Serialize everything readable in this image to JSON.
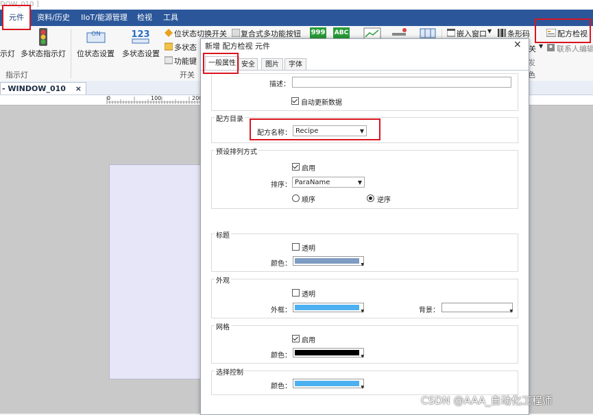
{
  "window_title_fragment": "DOW_010 ]",
  "menu": [
    "元件",
    "资料/历史",
    "IIoT/能源管理",
    "检视",
    "工具"
  ],
  "ribbon": {
    "indicator_lamp_partial": "示灯",
    "multi_state_indicator": "多状态指示灯",
    "group_indicator": "指示灯",
    "bit_state_setting": "位状态设置",
    "multi_state_setting": "多状态设置",
    "bit_state_toggle_switch": "位状态切换开关",
    "multi_state_partial": "多状态",
    "function_key": "功能键",
    "group_switch": "开关",
    "combo_button": "复合式多功能按钮",
    "numeric_icon_text": "999",
    "ascii_icon_text": "ABC",
    "embed_window": "嵌入窗口",
    "barcode": "条形码",
    "recipe_view": "配方检视",
    "close_partial": "关",
    "contact_editor": "联系人编辑",
    "send_partial": "发",
    "view_partial": "色"
  },
  "document_tab": {
    "label": "- WINDOW_010",
    "close": "×"
  },
  "ruler_ticks": [
    "0",
    "100",
    "200"
  ],
  "dialog": {
    "title": "新增 配方检视 元件",
    "close": "×",
    "tabs": [
      "一般属性",
      "安全",
      "图片",
      "字体"
    ],
    "description_label": "描述：",
    "description_value": "",
    "auto_update_label": "自动更新数据",
    "auto_update_checked": true,
    "recipe_dir": {
      "title": "配方目录",
      "name_label": "配方名称：",
      "name_value": "Recipe"
    },
    "sort": {
      "title": "预设排列方式",
      "enable_label": "启用",
      "enable_checked": true,
      "order_label": "排序：",
      "order_value": "ParaName",
      "ascending_label": "顺序",
      "descending_label": "逆序",
      "selected": "descending"
    },
    "header": {
      "title": "标题",
      "transparent_label": "透明",
      "transparent_checked": false,
      "color_label": "颜色：",
      "color": "#7f9cc2"
    },
    "appearance": {
      "title": "外观",
      "transparent_label": "透明",
      "transparent_checked": false,
      "frame_label": "外框：",
      "frame_color": "#4db0f0",
      "background_label": "背景：",
      "background_color": "#ffffff"
    },
    "grid": {
      "title": "网格",
      "enable_label": "启用",
      "enable_checked": true,
      "color_label": "颜色：",
      "color": "#000000"
    },
    "selection": {
      "title": "选择控制",
      "color_label": "颜色：",
      "color": "#4db0f0"
    }
  },
  "watermark": "CSDN @AAA_自动化工程师",
  "colors": {
    "menubar": "#2b579a",
    "highlight": "#d9141e"
  }
}
